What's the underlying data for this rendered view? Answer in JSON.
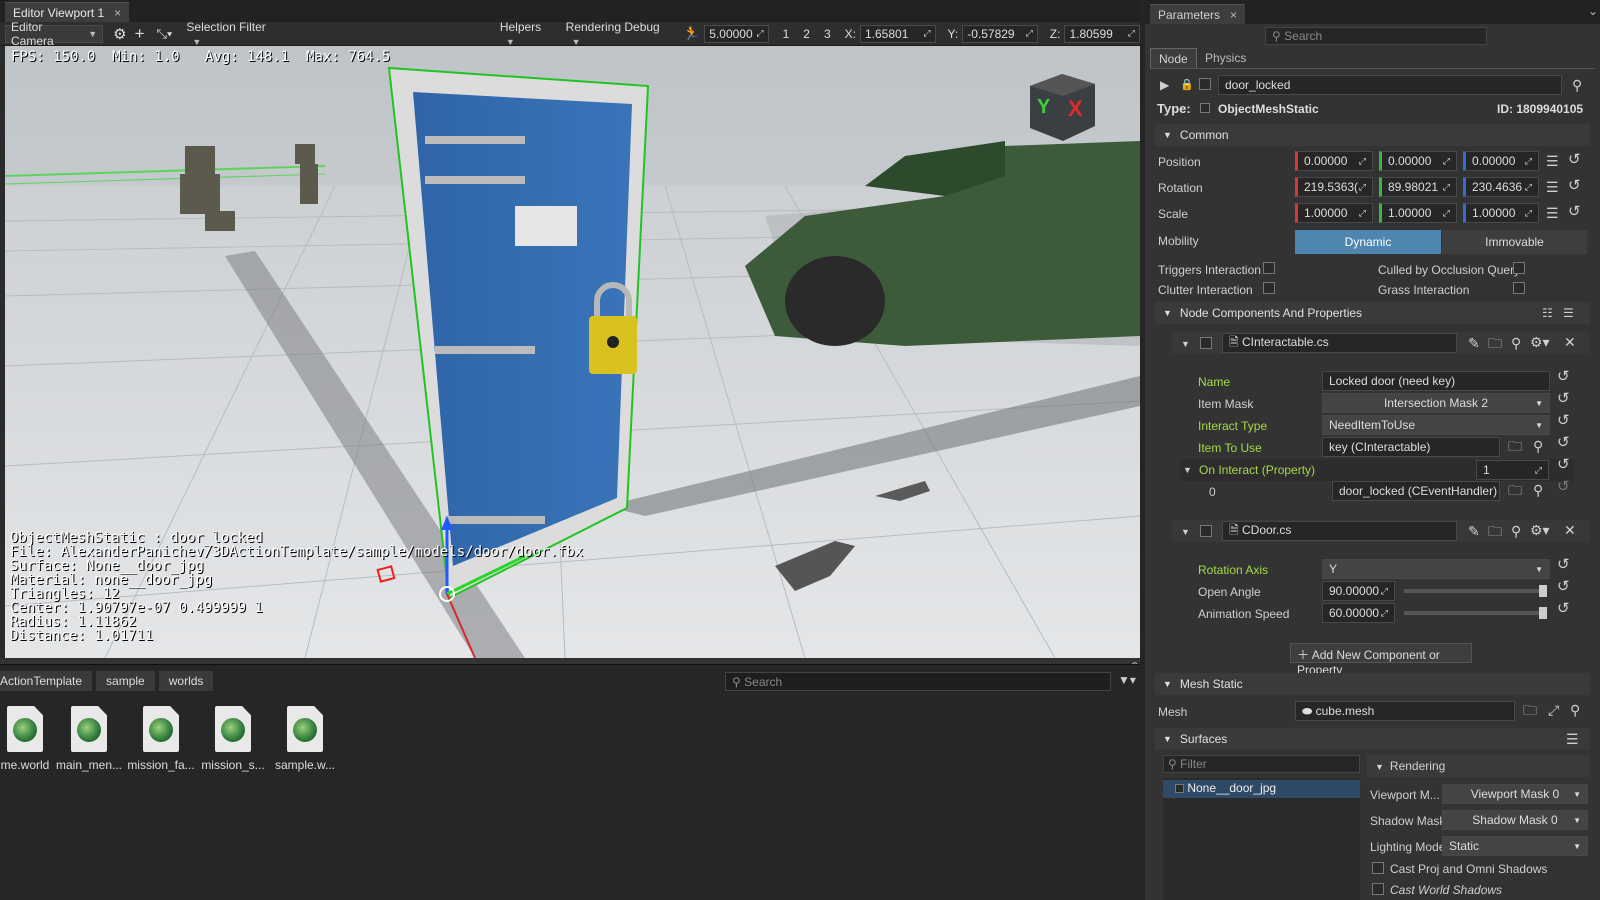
{
  "viewport_tab": {
    "title": "Editor Viewport 1",
    "close": "×"
  },
  "toolbar": {
    "camera": "Editor Camera",
    "selection_filter": "Selection Filter",
    "helpers": "Helpers",
    "rendering_debug": "Rendering Debug",
    "speed": "5.00000",
    "views": [
      "1",
      "2",
      "3"
    ],
    "x_label": "X:",
    "x_value": "1.65801",
    "y_label": "Y:",
    "y_value": "-0.57829",
    "z_label": "Z:",
    "z_value": "1.80599"
  },
  "hud": {
    "fps": "FPS: 150.0",
    "min": "Min: 1.0",
    "avg": "Avg: 148.1",
    "max": "Max: 764.5",
    "info": [
      "ObjectMeshStatic : door_locked",
      "File: AlexanderPanichev/3DActionTemplate/sample/models/door/door.fbx",
      "Surface: None__door_jpg",
      "Material: none__door_jpg",
      "Triangles: 12",
      "Center: 1.90797e-07 0.499999 1",
      "Radius: 1.11862",
      "Distance: 1.01711"
    ],
    "axis_y": "Y",
    "axis_x": "X"
  },
  "browser": {
    "breadcrumbs": [
      "ActionTemplate",
      "sample",
      "worlds"
    ],
    "search_placeholder": "Search",
    "files": [
      "me.world",
      "main_men...",
      "mission_fa...",
      "mission_s...",
      "sample.w..."
    ]
  },
  "params": {
    "tab_title": "Parameters",
    "close": "×",
    "search_placeholder": "Search",
    "subtabs": [
      "Node",
      "Physics"
    ],
    "node_name": "door_locked",
    "type_label": "Type:",
    "type_value": "ObjectMeshStatic",
    "id": "ID: 1809940105",
    "common": "Common",
    "position": {
      "label": "Position",
      "values": [
        "0.00000",
        "0.00000",
        "0.00000"
      ]
    },
    "rotation": {
      "label": "Rotation",
      "values": [
        "219.5363(",
        "89.98021",
        "230.4636"
      ]
    },
    "scale": {
      "label": "Scale",
      "values": [
        "1.00000",
        "1.00000",
        "1.00000"
      ]
    },
    "mobility": {
      "label": "Mobility",
      "dynamic": "Dynamic",
      "immovable": "Immovable"
    },
    "triggers_interaction": "Triggers Interaction",
    "culled_by_occlusion": "Culled by Occlusion Query",
    "clutter_interaction": "Clutter Interaction",
    "grass_interaction": "Grass Interaction",
    "node_components": "Node Components And Properties",
    "comp1": {
      "file": "CInteractable.cs",
      "name_label": "Name",
      "name_value": "Locked door (need key)",
      "item_mask_label": "Item Mask",
      "item_mask_value": "Intersection Mask 2",
      "interact_type_label": "Interact Type",
      "interact_type_value": "NeedItemToUse",
      "item_to_use_label": "Item To Use",
      "item_to_use_value": "key (CInteractable)",
      "on_interact_label": "On Interact (Property)",
      "on_interact_count": "1",
      "event_index": "0",
      "event_value": "door_locked (CEventHandler)"
    },
    "comp2": {
      "file": "CDoor.cs",
      "rotation_axis_label": "Rotation Axis",
      "rotation_axis_value": "Y",
      "open_angle_label": "Open Angle",
      "open_angle_value": "90.00000",
      "anim_speed_label": "Animation Speed",
      "anim_speed_value": "60.00000"
    },
    "add_component": "Add New Component or Property",
    "mesh_static": "Mesh Static",
    "mesh_label": "Mesh",
    "mesh_value": "cube.mesh",
    "surfaces": "Surfaces",
    "filter_placeholder": "Filter",
    "surface_item": "None__door_jpg",
    "rendering": "Rendering",
    "viewport_mask_label": "Viewport M...",
    "viewport_mask_value": "Viewport Mask 0",
    "shadow_mask_label": "Shadow Mask",
    "shadow_mask_value": "Shadow Mask 0",
    "lighting_mode_label": "Lighting Mode",
    "lighting_mode_value": "Static",
    "cast_proj": "Cast Proj and Omni Shadows",
    "cast_world": "Cast World Shadows"
  }
}
